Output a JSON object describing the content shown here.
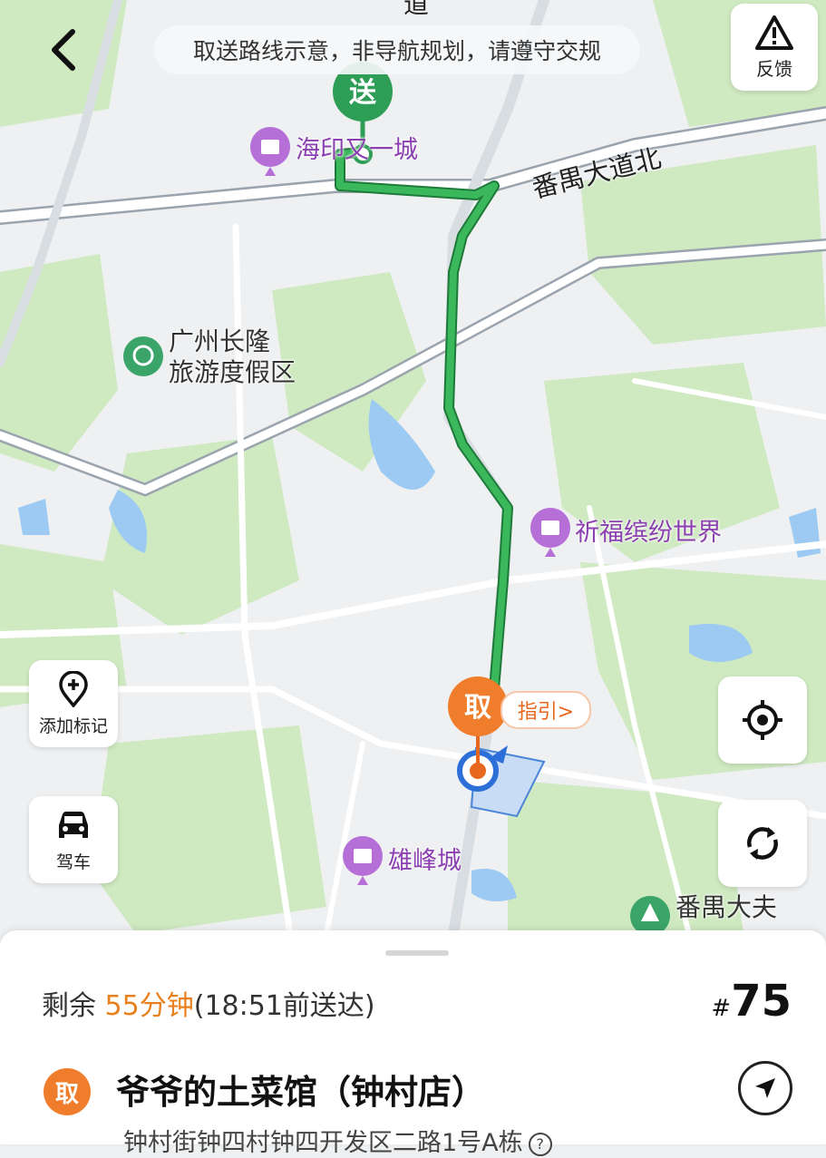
{
  "notice": "取送路线示意，非导航规划，请遵守交规",
  "feedback_label": "反馈",
  "map": {
    "poi": {
      "haiyin": "海印又一城",
      "changlong_line1": "广州长隆",
      "changlong_line2": "旅游度假区",
      "qifu": "祈福缤纷世界",
      "xiongfeng": "雄峰城",
      "panyu_dafu": "番禺大夫"
    },
    "road": "番禺大道北",
    "road_top": "道",
    "deliver_marker": "送",
    "pickup_marker": "取",
    "guide_label": "指引>"
  },
  "buttons": {
    "add_marker": "添加标记",
    "drive": "驾车"
  },
  "order": {
    "eta_prefix": "剩余 ",
    "eta_minutes": "55分钟",
    "eta_suffix": "(18:51前送达)",
    "number_hash": "#",
    "number": "75",
    "pickup_badge": "取",
    "shop_name": "爷爷的土菜馆（钟村店）",
    "address": "钟村街钟四村钟四开发区二路1号A栋",
    "address_help": "?"
  },
  "colors": {
    "route": "#2fa84f",
    "pickup": "#f07d2c",
    "deliver": "#2e9e57",
    "poi": "#8b3fb0"
  }
}
